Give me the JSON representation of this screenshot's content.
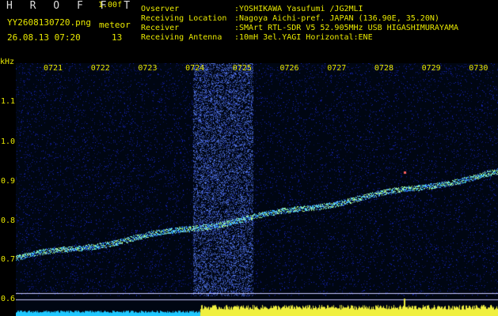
{
  "header": {
    "logo": "H R O F F T",
    "version": "1.00f",
    "filename": "YY2608130720.png",
    "event_label": "meteor",
    "datetime": "26.08.13 07:20",
    "count": "13"
  },
  "info": [
    {
      "key": "Ovserver",
      "value": ":YOSHIKAWA Yasufumi /JG2MLI"
    },
    {
      "key": "Receiving Location",
      "value": ":Nagoya Aichi-pref. JAPAN (136.90E, 35.20N)"
    },
    {
      "key": "Receiver",
      "value": ":SMArt RTL-SDR V5 52.905MHz USB HIGASHIMURAYAMA"
    },
    {
      "key": "Receiving Antenna",
      "value": ":10mH 3el.YAGI Horizontal:ENE"
    }
  ],
  "axis": {
    "unit": "kHz",
    "y_ticks": [
      "1.1",
      "1.0",
      "0.9",
      "0.8",
      "0.7",
      "0.6"
    ],
    "x_ticks": [
      "0721",
      "0722",
      "0723",
      "0724",
      "0725",
      "0726",
      "0727",
      "0728",
      "0729",
      "0730"
    ]
  },
  "colors": {
    "background": "#000010",
    "noise": "#1a2aa0",
    "trace": "#7fffa0",
    "text": "#e8e800",
    "power_low": "#00c8ff",
    "power_high": "#ffff40"
  }
}
